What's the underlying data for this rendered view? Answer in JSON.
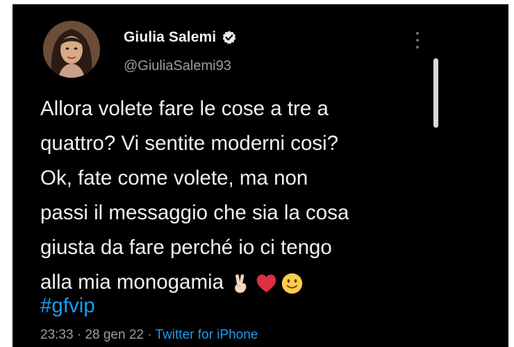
{
  "tweet": {
    "display_name": "Giulia Salemi",
    "handle": "@GiuliaSalemi93",
    "text_lines": [
      "Allora volete fare le cose a tre a",
      "quattro? Vi sentite moderni cosi?",
      "Ok, fate come volete, ma non",
      "passi il messaggio che sia la cosa",
      "giusta da fare perché io ci tengo",
      "alla mia monogamia"
    ],
    "emojis": [
      "victory-hand",
      "red-heart",
      "slightly-smiling-face"
    ],
    "hashtag": "#gfvip",
    "time": "23:33",
    "separator": " · ",
    "date": "28 gen 22",
    "source": "Twitter for iPhone"
  },
  "colors": {
    "background": "#000000",
    "text": "#f1f1f1",
    "muted": "#9a9da1",
    "link": "#1d9bf0"
  },
  "icons": {
    "verified": "verified-badge-icon",
    "more": "more-options-icon"
  }
}
